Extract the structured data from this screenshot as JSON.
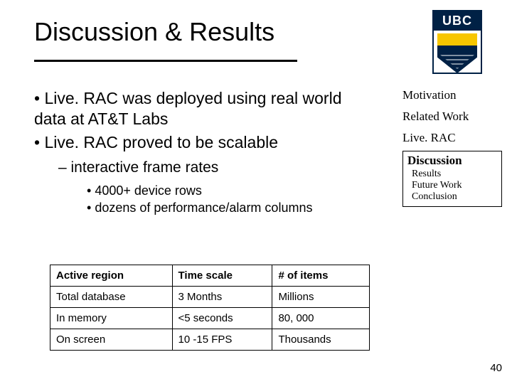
{
  "title": "Discussion & Results",
  "logo": {
    "text": "UBC"
  },
  "bullets": {
    "b0": "Live. RAC was deployed using real world data at AT&T Labs",
    "b1": "Live. RAC proved to be scalable",
    "s0": "interactive frame rates",
    "ss0": "4000+ device rows",
    "ss1": "dozens of performance/alarm columns"
  },
  "nav": {
    "n0": "Motivation",
    "n1": "Related Work",
    "n2": "Live. RAC",
    "box_head": "Discussion",
    "box_items": {
      "i0": "Results",
      "i1": "Future Work",
      "i2": "Conclusion"
    }
  },
  "table": {
    "headers": {
      "c0": "Active region",
      "c1": "Time scale",
      "c2": "# of items"
    },
    "rows": [
      {
        "c0": "Total database",
        "c1": "3 Months",
        "c2": "Millions"
      },
      {
        "c0": "In memory",
        "c1": "<5 seconds",
        "c2": "80, 000"
      },
      {
        "c0": "On screen",
        "c1": "10 -15 FPS",
        "c2": "Thousands"
      }
    ]
  },
  "page_number": "40"
}
